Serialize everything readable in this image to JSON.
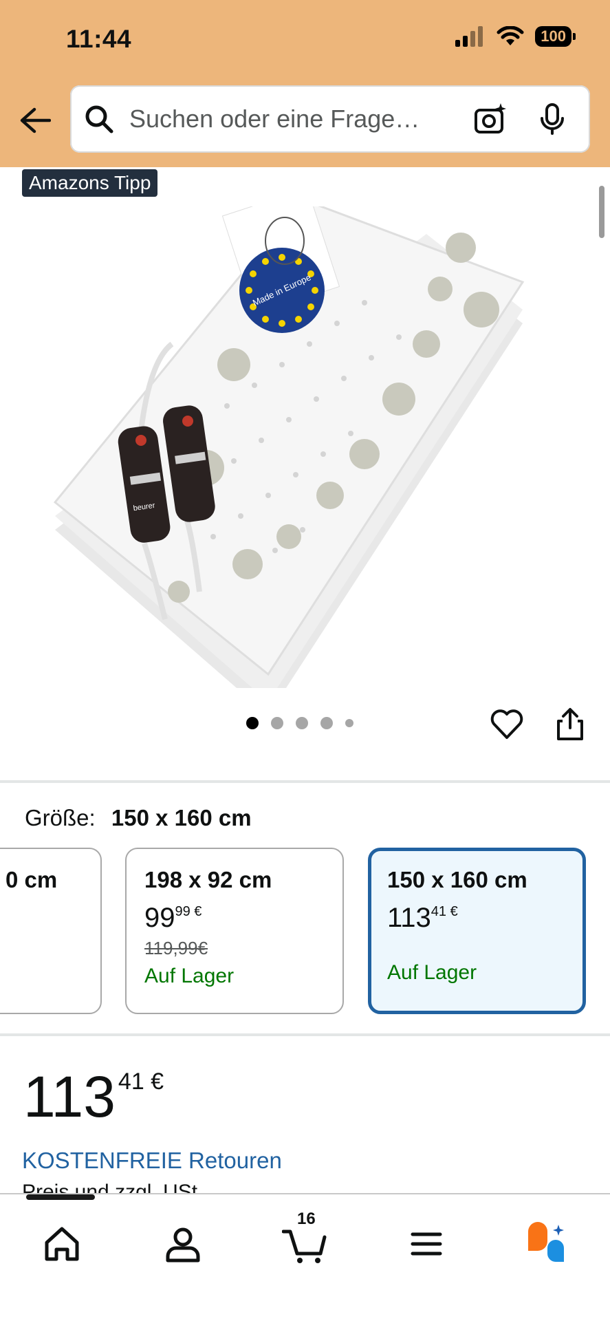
{
  "status_bar": {
    "time": "11:44",
    "battery": "100"
  },
  "search": {
    "placeholder": "Suchen oder eine Frage…"
  },
  "product": {
    "badge": "Amazons Tipp",
    "image_label": "Made in Europe",
    "image_brand": "beurer"
  },
  "gallery": {
    "dot_count": 5,
    "active_index": 0
  },
  "size": {
    "label": "Größe:",
    "selected_value": "150 x 160 cm",
    "options": [
      {
        "title": "0 cm"
      },
      {
        "title": "198 x 92 cm",
        "price_main": "99",
        "price_sup": "99 €",
        "old_price": "119,99€",
        "stock": "Auf Lager"
      },
      {
        "title": "150 x 160 cm",
        "price_main": "113",
        "price_sup": "41 €",
        "stock": "Auf Lager"
      }
    ]
  },
  "price": {
    "main": "113",
    "cents": "41 €"
  },
  "returns": "KOSTENFREIE Retouren",
  "vat_note": "Preis und zzgl. USt",
  "tabbar": {
    "cart_count": "16"
  },
  "colors": {
    "header": "#EDB67B",
    "link": "#2162a1",
    "stock": "#007600",
    "selected_border": "#2162a1"
  }
}
